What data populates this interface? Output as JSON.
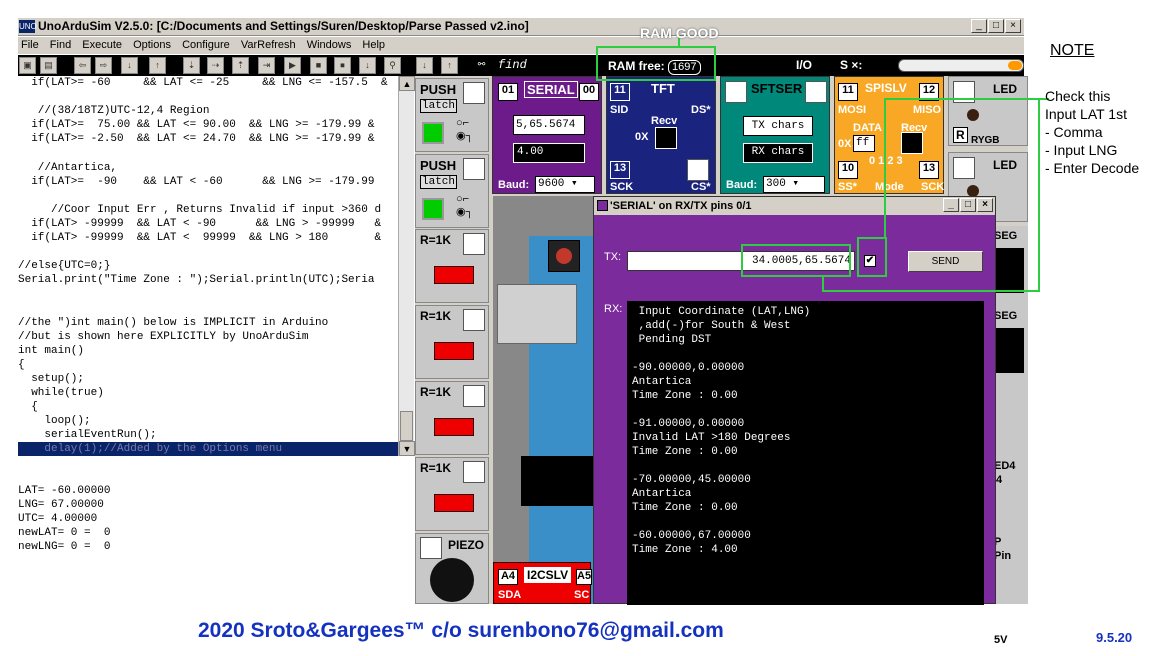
{
  "window": {
    "logo": "UNO",
    "title": "UnoArduSim V2.5.0:   [C:/Documents and Settings/Suren/Desktop/Parse Passed v2.ino]",
    "controls": [
      "_",
      "□",
      "×"
    ]
  },
  "menu": [
    "File",
    "Find",
    "Execute",
    "Options",
    "Configure",
    "VarRefresh",
    "Windows",
    "Help"
  ],
  "toolbar": {
    "find_label": "find",
    "ram_free_label": "RAM free:",
    "ram_free_value": "1697",
    "io_label": "I/O",
    "s_label": "S ×:"
  },
  "code_lines": [
    "  if(LAT>= -60     && LAT <= -25     && LNG <= -157.5  &",
    "",
    "   //(38/18TZ)UTC-12,4 Region",
    "  if(LAT>=  75.00 && LAT <= 90.00  && LNG >= -179.99 &",
    "  if(LAT>= -2.50  && LAT <= 24.70  && LNG >= -179.99 &",
    "",
    "   //Antartica,",
    "  if(LAT>=  -90    && LAT < -60      && LNG >= -179.99",
    "",
    "     //Coor Input Err , Returns Invalid if input >360 d",
    "  if(LAT> -99999  && LAT < -90      && LNG > -99999   &",
    "  if(LAT> -99999  && LAT <  99999  && LNG > 180       &",
    "",
    "//else{UTC=0;}",
    "Serial.print(\"Time Zone : \");Serial.println(UTC);Seria",
    "",
    "",
    "//the \")int main() below is IMPLICIT in Arduino",
    "//but is shown here EXPLICITLY by UnoArduSim",
    "int main()",
    "{",
    "  setup();",
    "  while(true)",
    "  {",
    "    loop();",
    "    serialEventRun();",
    "    delay(1);//Added by the Options menu"
  ],
  "variables": [
    "LAT= -60.00000",
    "LNG= 67.00000",
    "UTC= 4.00000",
    "newLAT= 0 =  0",
    "newLNG= 0 =  0"
  ],
  "bench": {
    "push1": {
      "title": "PUSH",
      "latch": "latch"
    },
    "push2": {
      "title": "PUSH",
      "latch": "latch"
    },
    "res1": "R=1K",
    "res2": "R=1K",
    "res3": "R=1K",
    "res4": "R=1K",
    "piezo": "PIEZO",
    "serial": {
      "pin_left": "01",
      "title": "SERIAL",
      "pin_right": "00",
      "tx_field": "5,65.5674",
      "rx_field": "4.00",
      "baud_label": "Baud:",
      "baud_value": "9600"
    },
    "tft": {
      "pin": "11",
      "title": "TFT",
      "sid": "SID",
      "ds": "DS*",
      "recv": "Recv",
      "ox": "0X",
      "pin13": "13",
      "sck": "SCK",
      "cs": "CS*"
    },
    "sftser": {
      "title": "SFTSER",
      "tx_chars": "TX chars",
      "rx_chars": "RX chars",
      "baud_label": "Baud:",
      "baud_value": "300"
    },
    "spislv": {
      "pin_left": "11",
      "title": "SPISLV",
      "pin_right": "12",
      "mosi": "MOSI",
      "miso": "MISO",
      "data": "DATA",
      "recv": "Recv",
      "ox": "0X",
      "ff": "ff",
      "pin10": "10",
      "modes": "0 1 2 3",
      "pin13": "13",
      "ss": "SS*",
      "mode": "Mode",
      "sck": "SCK"
    },
    "led1": {
      "title": "LED",
      "r": "R",
      "rygb": "RYGB"
    },
    "led2": {
      "title": "LED"
    },
    "i2c": {
      "pin": "A4",
      "title": "I2CSLV",
      "sda": "SDA",
      "pin2": "A5",
      "scl": "SC"
    },
    "right_labels": [
      "SEG",
      "SEG",
      "ED4",
      "4",
      "P",
      "Pin",
      "5V"
    ]
  },
  "dialog": {
    "title": "'SERIAL' on RX/TX pins 0/1",
    "tx_label": "TX:",
    "tx_value": "34.0005,65.5674",
    "checkbox": "✔",
    "send": "SEND",
    "rx_label": "RX:",
    "rx_text": " Input Coordinate (LAT,LNG)\n ,add(-)for South & West\n Pending DST\n\n-90.00000,0.00000\nAntartica\nTime Zone : 0.00\n\n-91.00000,0.00000\nInvalid LAT >180 Degrees\nTime Zone : 0.00\n\n-70.00000,45.00000\nAntartica\nTime Zone : 0.00\n\n-60.00000,67.00000\nTime Zone : 4.00"
  },
  "annotations": {
    "ram_good": "RAM GOOD",
    "note_title": "NOTE",
    "notes": [
      "Check this",
      "Input LAT 1st",
      "- Comma",
      "- Input LNG",
      "- Enter Decode"
    ]
  },
  "footer": {
    "credit": "2020 Sroto&Gargees™ c/o surenbono76@gmail.com",
    "version": "9.5.20"
  },
  "colors": {
    "annotation_green": "#2ecc40",
    "footer_blue": "#1431c0",
    "serial_purple": "#7b2b9c"
  }
}
